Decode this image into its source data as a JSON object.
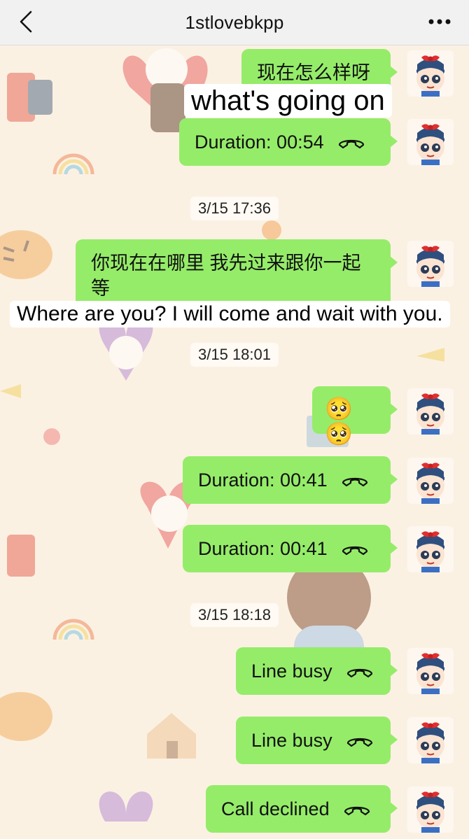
{
  "header": {
    "title": "1stlovebkpp",
    "back_icon": "chevron-left-icon",
    "more_icon": "ellipsis-icon"
  },
  "colors": {
    "header_bg": "#f1f1f1",
    "wallpaper": "#fbf1e3",
    "bubble": "#95ec69"
  },
  "messages": [
    {
      "type": "text",
      "text": "现在怎么样呀",
      "subtitle": "what's going on"
    },
    {
      "type": "call",
      "label": "Duration: 00:54"
    },
    {
      "type": "timestamp",
      "text": "3/15 17:36"
    },
    {
      "type": "text",
      "text": "你现在在哪里 我先过来跟你一起等",
      "subtitle": "Where are you? I will come and wait with you."
    },
    {
      "type": "timestamp",
      "text": "3/15 18:01"
    },
    {
      "type": "emoji",
      "text": "🥺🥺"
    },
    {
      "type": "call",
      "label": "Duration: 00:41"
    },
    {
      "type": "call",
      "label": "Duration: 00:41"
    },
    {
      "type": "timestamp",
      "text": "3/15 18:18"
    },
    {
      "type": "call",
      "label": "Line busy"
    },
    {
      "type": "call",
      "label": "Line busy"
    },
    {
      "type": "call",
      "label": "Call declined"
    }
  ]
}
